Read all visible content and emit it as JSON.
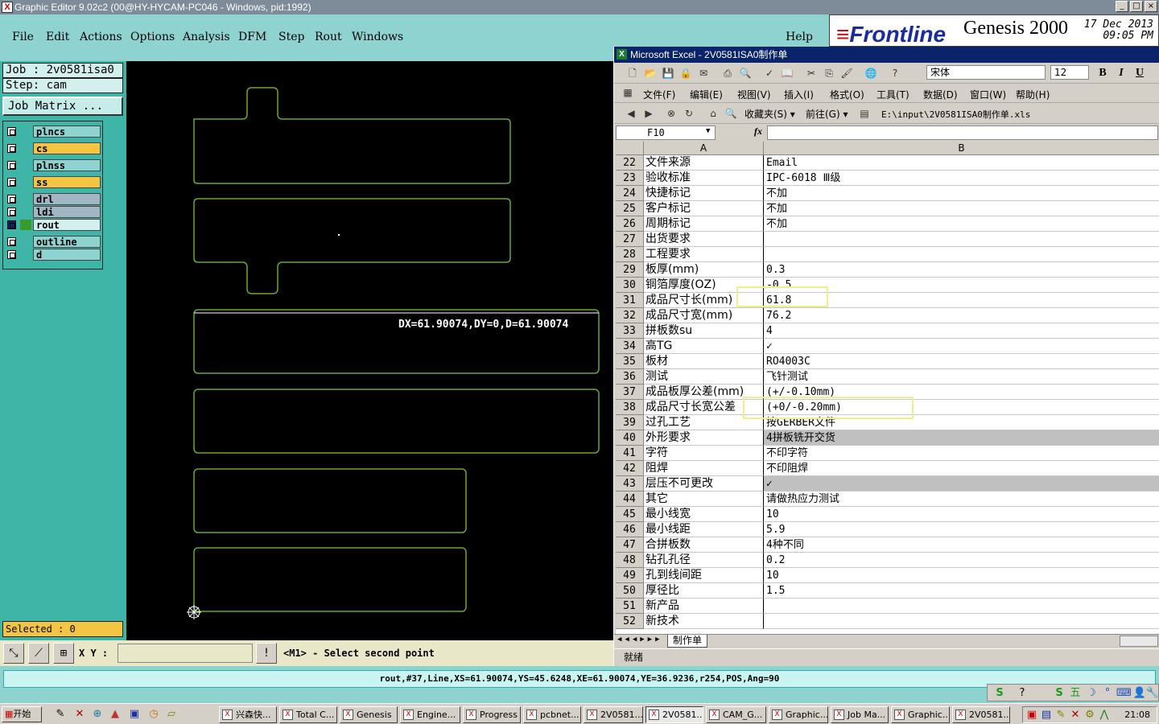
{
  "window": {
    "title": "Graphic Editor 9.02c2 (00@HY-HYCAM-PC046 - Windows, pid:1992)",
    "buttons": [
      "_",
      "□",
      "×"
    ]
  },
  "menu": {
    "items": [
      "File",
      "Edit",
      "Actions",
      "Options",
      "Analysis",
      "DFM",
      "Step",
      "Rout",
      "Windows"
    ],
    "help": "Help"
  },
  "banner": {
    "logo": "Frontline",
    "product": "Genesis 2000",
    "date": "17 Dec 2013",
    "time": "09:05 PM"
  },
  "left_panel": {
    "job": "Job : 2v0581isa0",
    "step": "Step: cam",
    "job_matrix": "Job Matrix ...",
    "layers": [
      {
        "name": "plncs",
        "color": "#8fd3d0"
      },
      {
        "name": "cs",
        "color": "#f4c543"
      },
      {
        "name": "plnss",
        "color": "#8fd3d0"
      },
      {
        "name": "ss",
        "color": "#f4c543"
      },
      {
        "name": "drl",
        "color": "#a3b6c4"
      },
      {
        "name": "ldi",
        "color": "#a3b6c4"
      },
      {
        "name": "rout",
        "color": "#d4f0ee"
      },
      {
        "name": "outline",
        "color": "#8fd3d0"
      },
      {
        "name": "d",
        "color": "#8fd3d0"
      }
    ],
    "selected": "Selected : 0"
  },
  "canvas": {
    "measure": "DX=61.90074,DY=0,D=61.90074",
    "outline_color": "#6aa832"
  },
  "bottom_bar": {
    "xy_label": "X Y :",
    "xy_value": "",
    "prompt": "<M1> - Select second point"
  },
  "status_line": "rout,#37,Line,XS=61.90074,YS=45.6248,XE=61.90074,YE=36.9236,r254,POS,Ang=90",
  "excel": {
    "title": "Microsoft Excel - 2V0581ISA0制作单",
    "menus": [
      "文件(F)",
      "编辑(E)",
      "视图(V)",
      "插入(I)",
      "格式(O)",
      "工具(T)",
      "数据(D)",
      "窗口(W)",
      "帮助(H)"
    ],
    "font": "宋体",
    "font_size": "12",
    "favorites": "收藏夹(S)",
    "goto": "前往(G)",
    "address": "E:\\input\\2V0581ISA0制作单.xls",
    "namebox": "F10",
    "fx": "fx",
    "columns": [
      "A",
      "B"
    ],
    "rows": [
      {
        "n": "22",
        "a": "文件来源",
        "b": "Email"
      },
      {
        "n": "23",
        "a": "验收标准",
        "b": "IPC-6018 Ⅲ级"
      },
      {
        "n": "24",
        "a": "快捷标记",
        "b": "不加"
      },
      {
        "n": "25",
        "a": "客户标记",
        "b": "不加"
      },
      {
        "n": "26",
        "a": "周期标记",
        "b": "不加"
      },
      {
        "n": "27",
        "a": "出货要求",
        "b": ""
      },
      {
        "n": "28",
        "a": "工程要求",
        "b": ""
      },
      {
        "n": "29",
        "a": "板厚(mm)",
        "b": "0.3"
      },
      {
        "n": "30",
        "a": "铜箔厚度(OZ)",
        "b": "-0.5"
      },
      {
        "n": "31",
        "a": "成品尺寸长(mm)",
        "b": "61.8"
      },
      {
        "n": "32",
        "a": "成品尺寸宽(mm)",
        "b": "76.2"
      },
      {
        "n": "33",
        "a": "拼板数su",
        "b": "4"
      },
      {
        "n": "34",
        "a": "高TG",
        "b": "✓"
      },
      {
        "n": "35",
        "a": "板材",
        "b": "RO4003C"
      },
      {
        "n": "36",
        "a": "测试",
        "b": "飞针测试"
      },
      {
        "n": "37",
        "a": "成品板厚公差(mm)",
        "b": "(+/-0.10mm)"
      },
      {
        "n": "38",
        "a": "成品尺寸长宽公差",
        "b": "(+0/-0.20mm)"
      },
      {
        "n": "39",
        "a": "过孔工艺",
        "b": "按GERBER文件"
      },
      {
        "n": "40",
        "a": "外形要求",
        "b": "4拼板铣开交货"
      },
      {
        "n": "41",
        "a": "字符",
        "b": "不印字符"
      },
      {
        "n": "42",
        "a": "阻焊",
        "b": "不印阻焊"
      },
      {
        "n": "43",
        "a": "层压不可更改",
        "b": "✓"
      },
      {
        "n": "44",
        "a": "其它",
        "b": "请做热应力测试"
      },
      {
        "n": "45",
        "a": "最小线宽",
        "b": "10"
      },
      {
        "n": "46",
        "a": "最小线距",
        "b": "5.9"
      },
      {
        "n": "47",
        "a": "合拼板数",
        "b": "4种不同"
      },
      {
        "n": "48",
        "a": "钻孔孔径",
        "b": "0.2"
      },
      {
        "n": "49",
        "a": "孔到线间距",
        "b": "10"
      },
      {
        "n": "50",
        "a": "厚径比",
        "b": "1.5"
      },
      {
        "n": "51",
        "a": "新产品",
        "b": ""
      },
      {
        "n": "52",
        "a": "新技术",
        "b": ""
      }
    ],
    "sheet_tab": "制作单",
    "status": "就绪"
  },
  "taskbar": {
    "start": "开始",
    "tasks": [
      "兴森快...",
      "Total C...",
      "Genesis",
      "Engine...",
      "Progress",
      "pcbnet...",
      "2V0581...",
      "2V0581...",
      "CAM_G...",
      "Graphic...",
      "Job Ma...",
      "Graphic...",
      "2V0581..."
    ],
    "clock": "21:08"
  }
}
